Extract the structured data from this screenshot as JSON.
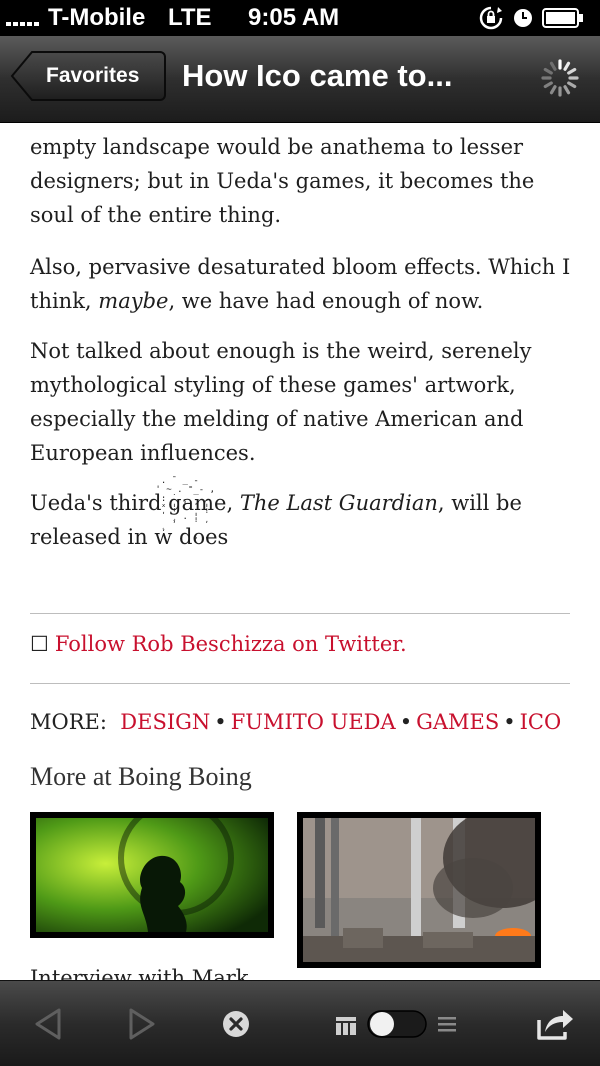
{
  "status_bar": {
    "carrier": "T-Mobile",
    "network": "LTE",
    "time": "9:05 AM"
  },
  "nav": {
    "back_label": "Favorites",
    "title": "How Ico came to..."
  },
  "article": {
    "p1": "empty landscape would be anathema to lesser designers; but in Ueda's games, it becomes the soul of the entire thing.",
    "p2_before": "Also, pervasive desaturated bloom effects. Which I think, ",
    "p2_em": "maybe",
    "p2_after": ", we have had enough of now.",
    "p3": "Not talked about enough is the weird, serenely mythological styling of these games' artwork, especially the melding of native American and European influences.",
    "p4_before": "Ueda's third game, ",
    "p4_em": "The Last Guardian",
    "p4_after": ", will be released in w does",
    "follow_text": "Follow Rob Beschizza on Twitter.",
    "more_label": "MORE:",
    "tags": [
      "DESIGN",
      "FUMITO UEDA",
      "GAMES",
      "ICO"
    ],
    "more_title": "More at Boing Boing",
    "caption": "Interview with Mark"
  },
  "colors": {
    "link": "#c8102e",
    "bar_dark": "#1c1c1c"
  },
  "toolbar": {
    "icons": [
      "back-arrow-icon",
      "forward-arrow-icon",
      "close-circle-icon",
      "reader-toggle",
      "share-icon"
    ]
  }
}
